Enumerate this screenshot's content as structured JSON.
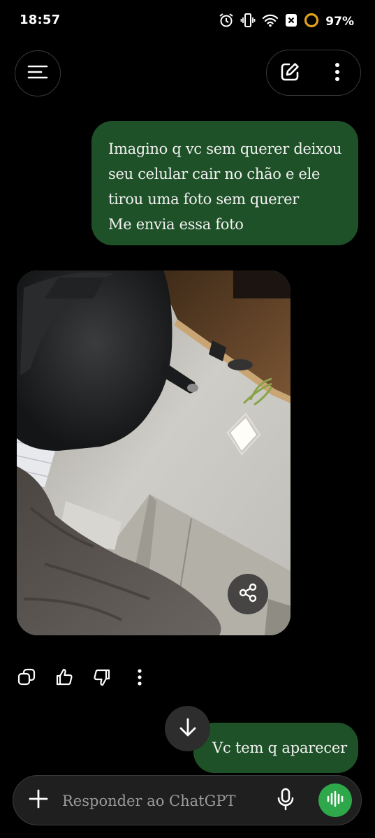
{
  "status_bar": {
    "time": "18:57",
    "battery": "97%",
    "icons": [
      "alarm-icon",
      "vibrate-icon",
      "wifi-icon",
      "notification-x-icon",
      "battery-ring-icon"
    ]
  },
  "header": {
    "icons": [
      "menu-icon",
      "compose-icon",
      "more-vertical-icon"
    ]
  },
  "messages": [
    {
      "role": "user",
      "lines": [
        "Imagino q vc sem querer deixou",
        "seu celular cair no chão e ele",
        "tirou uma foto sem querer",
        "Me envia essa foto"
      ]
    },
    {
      "role": "assistant",
      "type": "image",
      "actions": [
        "copy-icon",
        "thumbs-up-icon",
        "thumbs-down-icon",
        "more-vertical-icon"
      ],
      "overlay_icon": "share-icon"
    },
    {
      "role": "user",
      "text": "Vc tem q aparecer"
    }
  ],
  "scroll_icon": "arrow-down-icon",
  "composer": {
    "placeholder": "Responder ao ChatGPT",
    "icons": [
      "plus-icon",
      "microphone-icon",
      "voice-waveform-icon"
    ]
  },
  "colors": {
    "background": "#000000",
    "user_bubble": "#1f5128",
    "voice_button": "#2ea84a",
    "input_bar": "#1f1f1f"
  }
}
